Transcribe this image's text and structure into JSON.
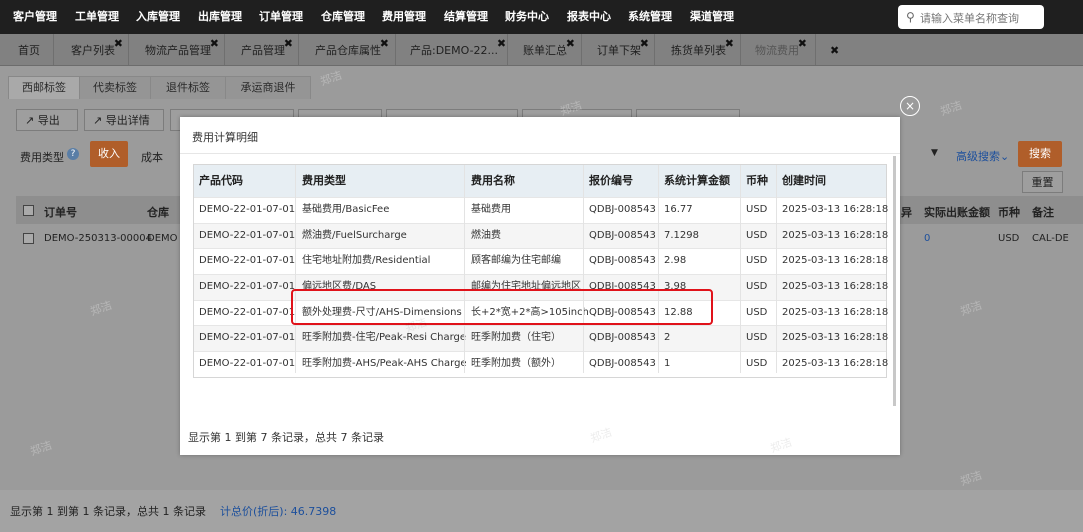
{
  "topnav": {
    "items": [
      "客户管理",
      "工单管理",
      "入库管理",
      "出库管理",
      "订单管理",
      "仓库管理",
      "费用管理",
      "结算管理",
      "财务中心",
      "报表中心",
      "系统管理",
      "渠道管理"
    ],
    "search_placeholder": "请输入菜单名称查询"
  },
  "tabs": [
    {
      "label": "首页"
    },
    {
      "label": "客户列表"
    },
    {
      "label": "物流产品管理"
    },
    {
      "label": "产品管理"
    },
    {
      "label": "产品仓库属性"
    },
    {
      "label": "产品:DEMO-22..."
    },
    {
      "label": "账单汇总"
    },
    {
      "label": "订单下架"
    },
    {
      "label": "拣货单列表"
    },
    {
      "label": "物流费用"
    }
  ],
  "tab_close_glyph": "✖",
  "subtabs": [
    "西邮标签",
    "代卖标签",
    "退件标签",
    "承运商退件"
  ],
  "toolbar": {
    "export": "导出",
    "export_detail": "导出详情"
  },
  "filters": {
    "fee_type_label": "费用类型",
    "income": "收入",
    "cost": "成本",
    "advanced_search": "高级搜索",
    "search": "搜索",
    "reset": "重置"
  },
  "bg_table": {
    "headers": [
      "订单号",
      "仓库",
      "异",
      "实际出账金额",
      "币种",
      "备注"
    ],
    "row": {
      "order": "DEMO-250313-00004",
      "warehouse": "DEMO",
      "actual": "0",
      "currency": "USD",
      "remark": "CAL-DE"
    }
  },
  "footer": {
    "records": "显示第 1 到第 1 条记录，总共 1 条记录",
    "total_label": "计总价(折后): 46.7398"
  },
  "modal": {
    "title": "费用计算明细",
    "headers": [
      "产品代码",
      "费用类型",
      "费用名称",
      "报价编号",
      "系统计算金额",
      "币种",
      "创建时间"
    ],
    "rows": [
      [
        "DEMO-22-01-07-01",
        "基础费用/BasicFee",
        "基础费用",
        "QDBJ-008543",
        "16.77",
        "USD",
        "2025-03-13 16:28:18"
      ],
      [
        "DEMO-22-01-07-01",
        "燃油费/FuelSurcharge",
        "燃油费",
        "QDBJ-008543",
        "7.1298",
        "USD",
        "2025-03-13 16:28:18"
      ],
      [
        "DEMO-22-01-07-01",
        "住宅地址附加费/Residential",
        "顾客邮编为住宅邮编",
        "QDBJ-008543",
        "2.98",
        "USD",
        "2025-03-13 16:28:18"
      ],
      [
        "DEMO-22-01-07-01",
        "偏远地区费/DAS",
        "邮编为住宅地址偏远地区",
        "QDBJ-008543",
        "3.98",
        "USD",
        "2025-03-13 16:28:18"
      ],
      [
        "DEMO-22-01-07-01",
        "额外处理费-尺寸/AHS-Dimensions",
        "长+2*宽+2*高>105inch",
        "QDBJ-008543",
        "12.88",
        "USD",
        "2025-03-13 16:28:18"
      ],
      [
        "DEMO-22-01-07-01",
        "旺季附加费-住宅/Peak-Resi Charge",
        "旺季附加费（住宅）",
        "QDBJ-008543",
        "2",
        "USD",
        "2025-03-13 16:28:18"
      ],
      [
        "DEMO-22-01-07-01",
        "旺季附加费-AHS/Peak-AHS Charge",
        "旺季附加费（额外）",
        "QDBJ-008543",
        "1",
        "USD",
        "2025-03-13 16:28:18"
      ]
    ],
    "footer": "显示第 1 到第 7 条记录，总共 7 条记录",
    "close_glyph": "×"
  },
  "watermark": "郑洁"
}
